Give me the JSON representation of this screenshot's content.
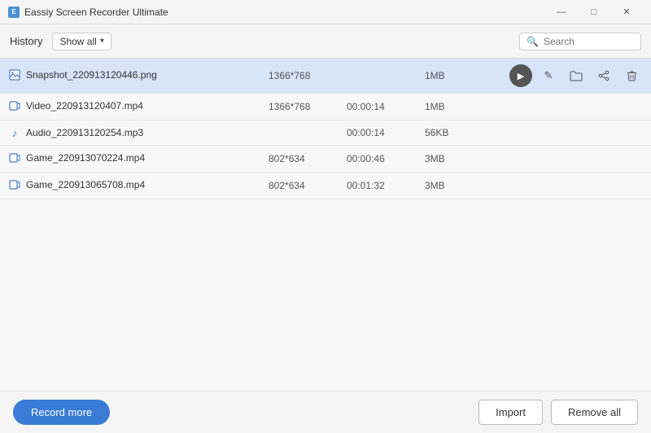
{
  "titleBar": {
    "appName": "Eassiy Screen Recorder Ultimate",
    "controls": {
      "minimize": "—",
      "maximize": "□",
      "close": "✕"
    }
  },
  "toolbar": {
    "historyLabel": "History",
    "filterLabel": "Show all",
    "searchPlaceholder": "Search"
  },
  "table": {
    "rows": [
      {
        "id": 1,
        "icon": "image",
        "name": "Snapshot_220913120446.png",
        "resolution": "1366*768",
        "duration": "",
        "size": "1MB",
        "selected": true
      },
      {
        "id": 2,
        "icon": "video",
        "name": "Video_220913120407.mp4",
        "resolution": "1366*768",
        "duration": "00:00:14",
        "size": "1MB",
        "selected": false
      },
      {
        "id": 3,
        "icon": "audio",
        "name": "Audio_220913120254.mp3",
        "resolution": "",
        "duration": "00:00:14",
        "size": "56KB",
        "selected": false
      },
      {
        "id": 4,
        "icon": "video",
        "name": "Game_220913070224.mp4",
        "resolution": "802*634",
        "duration": "00:00:46",
        "size": "3MB",
        "selected": false
      },
      {
        "id": 5,
        "icon": "video",
        "name": "Game_220913065708.mp4",
        "resolution": "802*634",
        "duration": "00:01:32",
        "size": "3MB",
        "selected": false
      }
    ],
    "actionIcons": {
      "play": "▶",
      "edit": "✎",
      "folder": "🗁",
      "share": "⇧",
      "delete": "🗑"
    }
  },
  "footer": {
    "recordMore": "Record more",
    "import": "Import",
    "removeAll": "Remove all"
  }
}
